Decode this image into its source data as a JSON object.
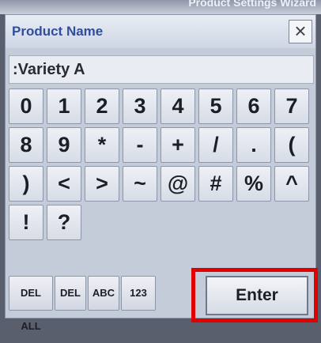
{
  "window": {
    "partial_title": "Product Settings Wizard"
  },
  "dialog": {
    "title": "Product Name",
    "close_label": "×"
  },
  "input": {
    "value": ":Variety A"
  },
  "keyboard": {
    "row1": [
      "0",
      "1",
      "2",
      "3",
      "4",
      "5",
      "6",
      "7"
    ],
    "row2": [
      "8",
      "9",
      "*",
      "-",
      "+",
      "/",
      ".",
      "("
    ],
    "row3": [
      ")",
      "<",
      ">",
      "~",
      "@",
      "#",
      "%",
      "^"
    ],
    "row4": [
      "!",
      "?"
    ]
  },
  "function_keys": {
    "del_all": "DEL ALL",
    "del": "DEL",
    "abc": "ABC",
    "num": "123",
    "enter": "Enter"
  },
  "colors": {
    "highlight": "#e00000",
    "title": "#2f4e9c"
  }
}
